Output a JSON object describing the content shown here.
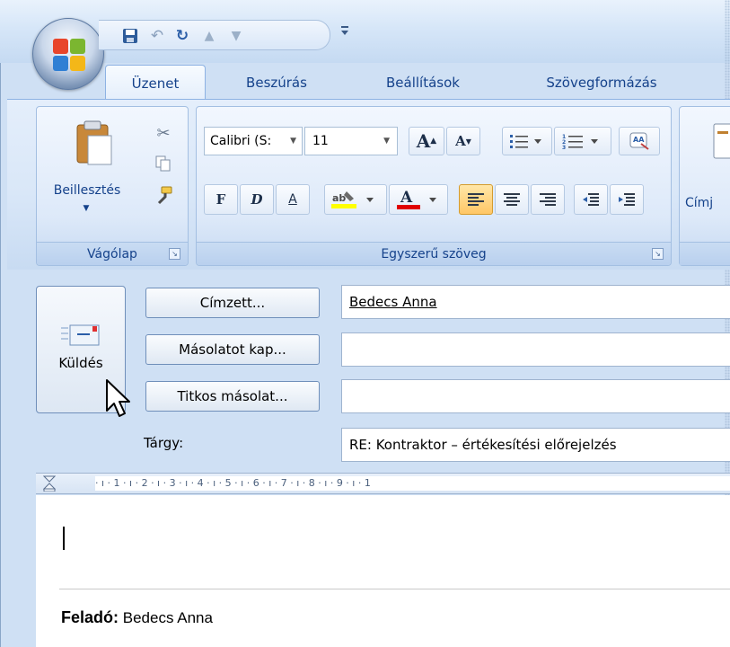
{
  "quick_access": {
    "icons": [
      "save-icon",
      "undo-icon",
      "redo-icon",
      "up-arrow-icon",
      "down-arrow-icon",
      "customize-dropdown-icon"
    ]
  },
  "tabs": [
    {
      "label": "Üzenet",
      "active": true
    },
    {
      "label": "Beszúrás",
      "active": false
    },
    {
      "label": "Beállítások",
      "active": false
    },
    {
      "label": "Szövegformázás",
      "active": false
    }
  ],
  "ribbon": {
    "clipboard": {
      "group_label": "Vágólap",
      "paste_label": "Beillesztés"
    },
    "basic_text": {
      "group_label": "Egyszerű szöveg",
      "font_name": "Calibri (S:",
      "font_size": "11",
      "grow_font": "A",
      "shrink_font": "A",
      "bold": "F",
      "italic": "D",
      "underline": "A",
      "font_color": "A"
    },
    "names": {
      "partial_label": "Címj"
    }
  },
  "colors": {
    "highlight": "#ffff00",
    "font_color": "#e00000",
    "accent": "#15428b"
  },
  "message": {
    "send_label": "Küldés",
    "to_button": "Címzett...",
    "cc_button": "Másolatot kap...",
    "bcc_button": "Titkos másolat...",
    "subject_label": "Tárgy:",
    "to_value": "Bedecs Anna",
    "cc_value": "",
    "bcc_value": "",
    "subject_value": "RE:  Kontraktor – értékesítési előrejelzés"
  },
  "ruler": {
    "ticks": "· ı · 1 · ı · 2 · ı · 3 · ı · 4 · ı · 5 · ı · 6 · ı · 7 · ı · 8 · ı · 9 · ı · 1"
  },
  "body": {
    "from_label": "Feladó:",
    "from_value": "Bedecs Anna"
  }
}
